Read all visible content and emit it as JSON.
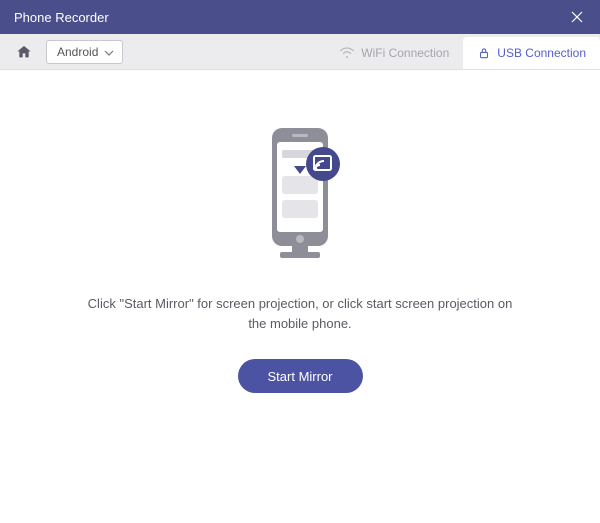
{
  "titlebar": {
    "title": "Phone Recorder"
  },
  "toolbar": {
    "platform": "Android",
    "tabs": {
      "wifi": "WiFi Connection",
      "usb": "USB Connection"
    }
  },
  "main": {
    "instruction": "Click \"Start Mirror\" for screen projection, or click start screen projection on the mobile phone.",
    "start_button": "Start Mirror"
  },
  "colors": {
    "accent": "#4d53a3",
    "titlebar": "#4a4e8a"
  }
}
